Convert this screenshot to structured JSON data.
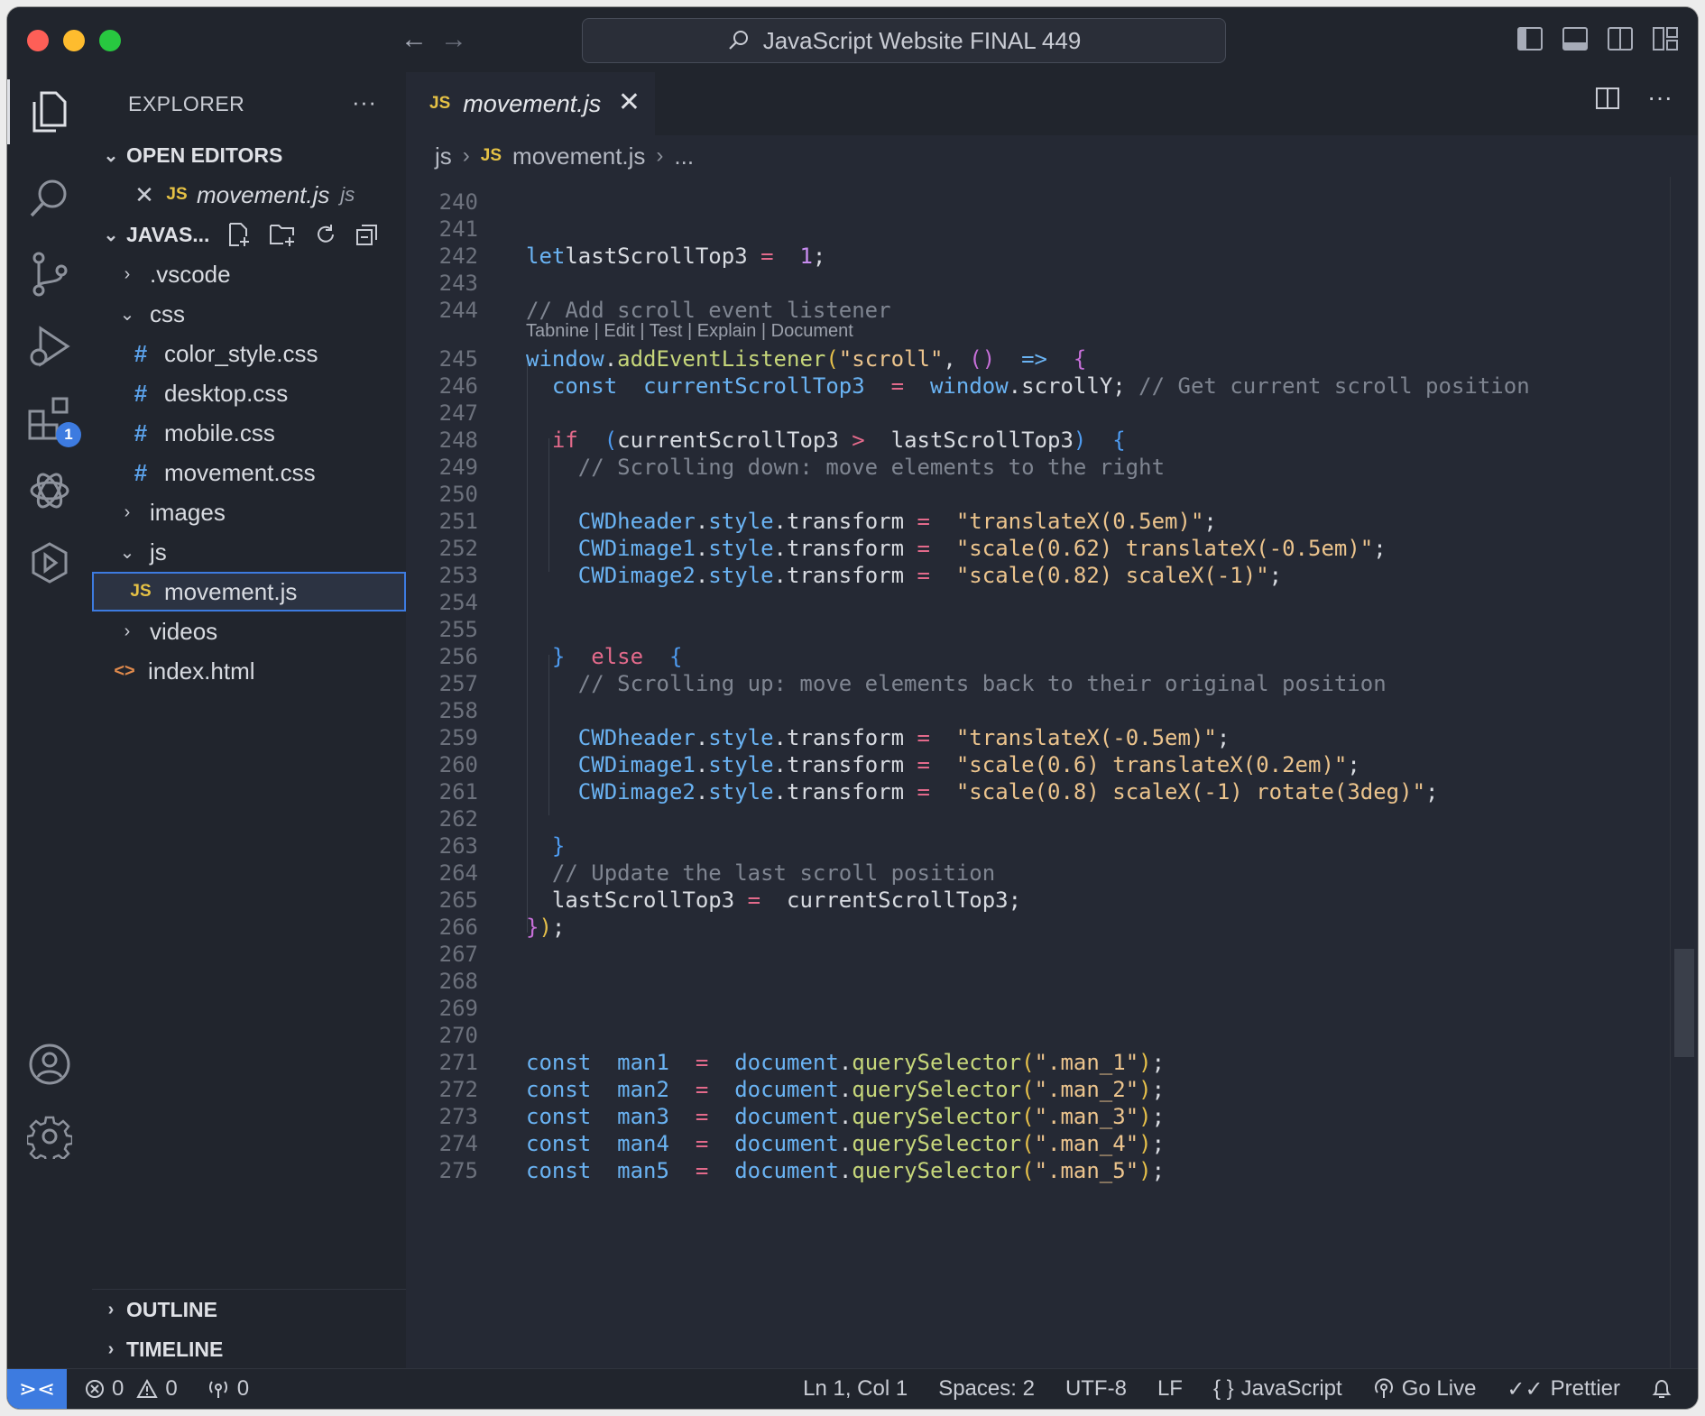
{
  "window": {
    "title": "JavaScript Website FINAL 449"
  },
  "sidebar": {
    "header": "EXPLORER",
    "more": "···",
    "open_editors": {
      "title": "OPEN EDITORS",
      "items": [
        {
          "name": "movement.js",
          "dir": "js"
        }
      ]
    },
    "workspace": {
      "title": "JAVAS...",
      "tree": [
        {
          "label": ".vscode",
          "kind": "folder",
          "open": false,
          "depth": 1
        },
        {
          "label": "css",
          "kind": "folder",
          "open": true,
          "depth": 1
        },
        {
          "label": "color_style.css",
          "kind": "css",
          "depth": 2
        },
        {
          "label": "desktop.css",
          "kind": "css",
          "depth": 2
        },
        {
          "label": "mobile.css",
          "kind": "css",
          "depth": 2
        },
        {
          "label": "movement.css",
          "kind": "css",
          "depth": 2
        },
        {
          "label": "images",
          "kind": "folder",
          "open": false,
          "depth": 1
        },
        {
          "label": "js",
          "kind": "folder",
          "open": true,
          "depth": 1
        },
        {
          "label": "movement.js",
          "kind": "js",
          "depth": 2,
          "selected": true
        },
        {
          "label": "videos",
          "kind": "folder",
          "open": false,
          "depth": 1
        },
        {
          "label": "index.html",
          "kind": "html",
          "depth": 1
        }
      ]
    },
    "outline": "OUTLINE",
    "timeline": "TIMELINE"
  },
  "activity": {
    "extensions_badge": "1"
  },
  "editor": {
    "tab_label": "movement.js",
    "tab_icon": "JS",
    "breadcrumbs": [
      "js",
      "movement.js",
      "..."
    ],
    "codelens": "Tabnine | Edit | Test | Explain | Document",
    "lines": [
      {
        "n": "240",
        "tokens": []
      },
      {
        "n": "241",
        "tokens": []
      },
      {
        "n": "242",
        "tokens": [
          [
            "k-kw",
            "let"
          ],
          [
            "",
            "lastScrollTop3 "
          ],
          [
            "k-op",
            "="
          ],
          [
            "",
            "  "
          ],
          [
            "k-num",
            "1"
          ],
          [
            "",
            ";"
          ]
        ]
      },
      {
        "n": "243",
        "tokens": []
      },
      {
        "n": "244",
        "tokens": [
          [
            "k-com",
            "// Add scroll event listener"
          ]
        ]
      },
      {
        "n": "245",
        "tokens": [
          [
            "k-var",
            "window"
          ],
          [
            "",
            "."
          ],
          [
            "k-fn",
            "addEventListener"
          ],
          [
            "k-brace",
            "("
          ],
          [
            "k-str",
            "\"scroll\""
          ],
          [
            "",
            ", "
          ],
          [
            "k-paren",
            "()"
          ],
          [
            "",
            "  "
          ],
          [
            "k-kw",
            "=>"
          ],
          [
            "",
            "  "
          ],
          [
            "k-paren",
            "{"
          ]
        ]
      },
      {
        "n": "246",
        "tokens": [
          [
            "",
            "  "
          ],
          [
            "k-kw",
            "const"
          ],
          [
            "",
            "  "
          ],
          [
            "k-var",
            "currentScrollTop3"
          ],
          [
            "",
            "  "
          ],
          [
            "k-op",
            "="
          ],
          [
            "",
            "  "
          ],
          [
            "k-var",
            "window"
          ],
          [
            "",
            ".scrollY; "
          ],
          [
            "k-com",
            "// Get current scroll position"
          ]
        ]
      },
      {
        "n": "247",
        "tokens": []
      },
      {
        "n": "248",
        "tokens": [
          [
            "",
            "  "
          ],
          [
            "k-ctrl",
            "if"
          ],
          [
            "",
            "  "
          ],
          [
            "k-br2",
            "("
          ],
          [
            "",
            "currentScrollTop3 "
          ],
          [
            "k-op",
            ">"
          ],
          [
            "",
            "  lastScrollTop3"
          ],
          [
            "k-br2",
            ")"
          ],
          [
            "",
            "  "
          ],
          [
            "k-br2",
            "{"
          ]
        ]
      },
      {
        "n": "249",
        "tokens": [
          [
            "",
            "    "
          ],
          [
            "k-com",
            "// Scrolling down: move elements to the right"
          ]
        ]
      },
      {
        "n": "250",
        "tokens": []
      },
      {
        "n": "251",
        "tokens": [
          [
            "",
            "    "
          ],
          [
            "k-var",
            "CWDheader"
          ],
          [
            "",
            "."
          ],
          [
            "k-var",
            "style"
          ],
          [
            "",
            ".transform "
          ],
          [
            "k-op",
            "="
          ],
          [
            "",
            "  "
          ],
          [
            "k-str",
            "\"translateX(0.5em)\""
          ],
          [
            "",
            ";"
          ]
        ]
      },
      {
        "n": "252",
        "tokens": [
          [
            "",
            "    "
          ],
          [
            "k-var",
            "CWDimage1"
          ],
          [
            "",
            "."
          ],
          [
            "k-var",
            "style"
          ],
          [
            "",
            ".transform "
          ],
          [
            "k-op",
            "="
          ],
          [
            "",
            "  "
          ],
          [
            "k-str",
            "\"scale(0.62) translateX(-0.5em)\""
          ],
          [
            "",
            ";"
          ]
        ]
      },
      {
        "n": "253",
        "tokens": [
          [
            "",
            "    "
          ],
          [
            "k-var",
            "CWDimage2"
          ],
          [
            "",
            "."
          ],
          [
            "k-var",
            "style"
          ],
          [
            "",
            ".transform "
          ],
          [
            "k-op",
            "="
          ],
          [
            "",
            "  "
          ],
          [
            "k-str",
            "\"scale(0.82) scaleX(-1)\""
          ],
          [
            "",
            ";"
          ]
        ]
      },
      {
        "n": "254",
        "tokens": []
      },
      {
        "n": "255",
        "tokens": []
      },
      {
        "n": "256",
        "tokens": [
          [
            "",
            "  "
          ],
          [
            "k-br2",
            "}"
          ],
          [
            "",
            "  "
          ],
          [
            "k-ctrl",
            "else"
          ],
          [
            "",
            "  "
          ],
          [
            "k-br2",
            "{"
          ]
        ]
      },
      {
        "n": "257",
        "tokens": [
          [
            "",
            "    "
          ],
          [
            "k-com",
            "// Scrolling up: move elements back to their original position"
          ]
        ]
      },
      {
        "n": "258",
        "tokens": []
      },
      {
        "n": "259",
        "tokens": [
          [
            "",
            "    "
          ],
          [
            "k-var",
            "CWDheader"
          ],
          [
            "",
            "."
          ],
          [
            "k-var",
            "style"
          ],
          [
            "",
            ".transform "
          ],
          [
            "k-op",
            "="
          ],
          [
            "",
            "  "
          ],
          [
            "k-str",
            "\"translateX(-0.5em)\""
          ],
          [
            "",
            ";"
          ]
        ]
      },
      {
        "n": "260",
        "tokens": [
          [
            "",
            "    "
          ],
          [
            "k-var",
            "CWDimage1"
          ],
          [
            "",
            "."
          ],
          [
            "k-var",
            "style"
          ],
          [
            "",
            ".transform "
          ],
          [
            "k-op",
            "="
          ],
          [
            "",
            "  "
          ],
          [
            "k-str",
            "\"scale(0.6) translateX(0.2em)\""
          ],
          [
            "",
            ";"
          ]
        ]
      },
      {
        "n": "261",
        "tokens": [
          [
            "",
            "    "
          ],
          [
            "k-var",
            "CWDimage2"
          ],
          [
            "",
            "."
          ],
          [
            "k-var",
            "style"
          ],
          [
            "",
            ".transform "
          ],
          [
            "k-op",
            "="
          ],
          [
            "",
            "  "
          ],
          [
            "k-str",
            "\"scale(0.8) scaleX(-1) rotate(3deg)\""
          ],
          [
            "",
            ";"
          ]
        ]
      },
      {
        "n": "262",
        "tokens": []
      },
      {
        "n": "263",
        "tokens": [
          [
            "",
            "  "
          ],
          [
            "k-br2",
            "}"
          ]
        ]
      },
      {
        "n": "264",
        "tokens": [
          [
            "",
            "  "
          ],
          [
            "k-com",
            "// Update the last scroll position"
          ]
        ]
      },
      {
        "n": "265",
        "tokens": [
          [
            "",
            "  lastScrollTop3 "
          ],
          [
            "k-op",
            "="
          ],
          [
            "",
            "  currentScrollTop3;"
          ]
        ]
      },
      {
        "n": "266",
        "tokens": [
          [
            "k-paren",
            "}"
          ],
          [
            "k-brace",
            ")"
          ],
          [
            "",
            ";"
          ]
        ]
      },
      {
        "n": "267",
        "tokens": []
      },
      {
        "n": "268",
        "tokens": []
      },
      {
        "n": "269",
        "tokens": []
      },
      {
        "n": "270",
        "tokens": []
      },
      {
        "n": "271",
        "tokens": [
          [
            "k-kw",
            "const"
          ],
          [
            "",
            "  "
          ],
          [
            "k-var",
            "man1"
          ],
          [
            "",
            "  "
          ],
          [
            "k-op",
            "="
          ],
          [
            "",
            "  "
          ],
          [
            "k-var",
            "document"
          ],
          [
            "",
            "."
          ],
          [
            "k-fn",
            "querySelector"
          ],
          [
            "k-brace",
            "("
          ],
          [
            "k-str",
            "\".man_1\""
          ],
          [
            "k-brace",
            ")"
          ],
          [
            "",
            ";"
          ]
        ]
      },
      {
        "n": "272",
        "tokens": [
          [
            "k-kw",
            "const"
          ],
          [
            "",
            "  "
          ],
          [
            "k-var",
            "man2"
          ],
          [
            "",
            "  "
          ],
          [
            "k-op",
            "="
          ],
          [
            "",
            "  "
          ],
          [
            "k-var",
            "document"
          ],
          [
            "",
            "."
          ],
          [
            "k-fn",
            "querySelector"
          ],
          [
            "k-brace",
            "("
          ],
          [
            "k-str",
            "\".man_2\""
          ],
          [
            "k-brace",
            ")"
          ],
          [
            "",
            ";"
          ]
        ]
      },
      {
        "n": "273",
        "tokens": [
          [
            "k-kw",
            "const"
          ],
          [
            "",
            "  "
          ],
          [
            "k-var",
            "man3"
          ],
          [
            "",
            "  "
          ],
          [
            "k-op",
            "="
          ],
          [
            "",
            "  "
          ],
          [
            "k-var",
            "document"
          ],
          [
            "",
            "."
          ],
          [
            "k-fn",
            "querySelector"
          ],
          [
            "k-brace",
            "("
          ],
          [
            "k-str",
            "\".man_3\""
          ],
          [
            "k-brace",
            ")"
          ],
          [
            "",
            ";"
          ]
        ]
      },
      {
        "n": "274",
        "tokens": [
          [
            "k-kw",
            "const"
          ],
          [
            "",
            "  "
          ],
          [
            "k-var",
            "man4"
          ],
          [
            "",
            "  "
          ],
          [
            "k-op",
            "="
          ],
          [
            "",
            "  "
          ],
          [
            "k-var",
            "document"
          ],
          [
            "",
            "."
          ],
          [
            "k-fn",
            "querySelector"
          ],
          [
            "k-brace",
            "("
          ],
          [
            "k-str",
            "\".man_4\""
          ],
          [
            "k-brace",
            ")"
          ],
          [
            "",
            ";"
          ]
        ]
      },
      {
        "n": "275",
        "tokens": [
          [
            "k-kw",
            "const"
          ],
          [
            "",
            "  "
          ],
          [
            "k-var",
            "man5"
          ],
          [
            "",
            "  "
          ],
          [
            "k-op",
            "="
          ],
          [
            "",
            "  "
          ],
          [
            "k-var",
            "document"
          ],
          [
            "",
            "."
          ],
          [
            "k-fn",
            "querySelector"
          ],
          [
            "k-brace",
            "("
          ],
          [
            "k-str",
            "\".man_5\""
          ],
          [
            "k-brace",
            ")"
          ],
          [
            "",
            ";"
          ]
        ]
      }
    ]
  },
  "status": {
    "errors": "0",
    "warnings": "0",
    "ports": "0",
    "position": "Ln 1, Col 1",
    "spaces": "Spaces: 2",
    "encoding": "UTF-8",
    "eol": "LF",
    "language": "JavaScript",
    "golive": "Go Live",
    "prettier": "Prettier"
  }
}
